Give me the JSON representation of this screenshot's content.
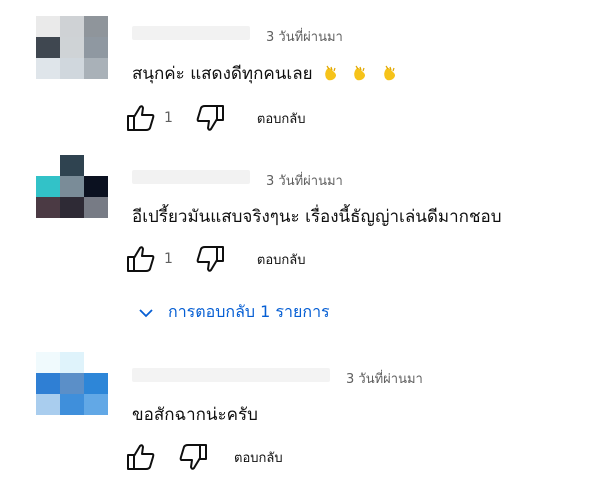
{
  "comments": [
    {
      "time": "3 วันที่ผ่านมา",
      "text": "สนุกค่ะ แสดงดีทุกคนเลย",
      "emoji": "clapping-hands-emoji",
      "like_count": "1",
      "reply_label": "ตอบกลับ",
      "avatar_colors": [
        "#eaeaea",
        "#cfd2d5",
        "#8f959b",
        "#3f4750",
        "#cfd3d6",
        "#8f98a1",
        "#dfe5ea",
        "#d0d7dd",
        "#a9b1b8"
      ]
    },
    {
      "time": "3 วันที่ผ่านมา",
      "text": "อีเปรี้ยวมันแสบจริงๆนะ เรื่องนี้ธัญญ่าเล่นดีมากชอบ",
      "like_count": "1",
      "reply_label": "ตอบกลับ",
      "avatar_colors": [
        "#ffffff",
        "#2f4350",
        "#ffffff",
        "#32c2c8",
        "#7a8c98",
        "#0b1120",
        "#4b3a44",
        "#2e2a35",
        "#777b85"
      ]
    },
    {
      "time": "3 วันที่ผ่านมา",
      "text": "ขอสักฉากน่ะครับ",
      "like_count": "",
      "reply_label": "ตอบกลับ",
      "avatar_colors": [
        "#f0fafd",
        "#dff3fb",
        "#ffffff",
        "#2f7fd4",
        "#5b8fc8",
        "#2d86d8",
        "#a9cdee",
        "#3f8fdb",
        "#62a8e6"
      ]
    }
  ],
  "replies_toggle": {
    "label": "การตอบกลับ 1 รายการ",
    "color": "#065fd4"
  }
}
